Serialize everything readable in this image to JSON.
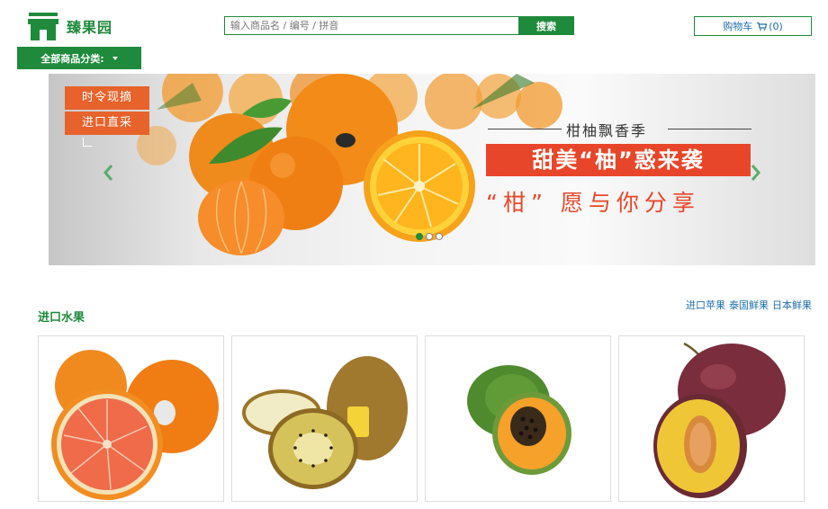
{
  "brand": {
    "name": "臻果园",
    "icon": "store-icon",
    "color": "#1f8a3c"
  },
  "search": {
    "placeholder": "输入商品名 / 编号 / 拼音",
    "button_label": "搜索"
  },
  "cart": {
    "label": "购物车",
    "count": "(0)",
    "icon": "cart-icon"
  },
  "category_menu": {
    "label": "全部商品分类:"
  },
  "banner": {
    "tags": [
      "时令现摘",
      "进口直采"
    ],
    "headline": "柑柚飘香季",
    "slogan_main": "甜美“柚”惑来袭",
    "slogan_sub": "“柑” 愿与你分享",
    "slides_total": 3,
    "active_slide": 1
  },
  "section": {
    "title": "进口水果",
    "links": [
      "进口苹果",
      "泰国鲜果",
      "日本鲜果"
    ],
    "products": [
      {
        "name": "blood-orange"
      },
      {
        "name": "kiwi"
      },
      {
        "name": "papaya"
      },
      {
        "name": "plum"
      }
    ]
  },
  "colors": {
    "accent": "#1f8a3c",
    "banner_red": "#e8462a",
    "link": "#1f6fa8"
  }
}
